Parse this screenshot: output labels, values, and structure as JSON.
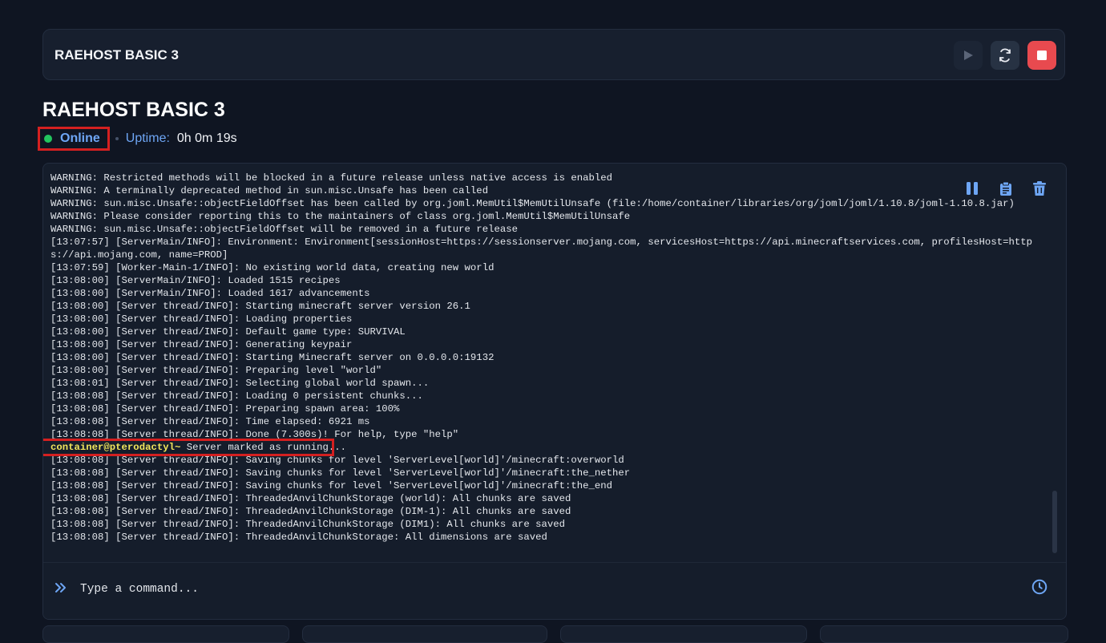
{
  "header": {
    "title": "RAEHOST BASIC 3",
    "controls": [
      "play-icon",
      "refresh-icon",
      "stop-icon"
    ],
    "stop_color": "#e84a4f"
  },
  "server": {
    "name": "RAEHOST BASIC 3",
    "status": "Online",
    "status_color": "#22c55e",
    "uptime_label": "Uptime:",
    "uptime_value": "0h 0m 19s"
  },
  "console": {
    "lines": [
      "WARNING: Restricted methods will be blocked in a future release unless native access is enabled",
      "WARNING: A terminally deprecated method in sun.misc.Unsafe has been called",
      "WARNING: sun.misc.Unsafe::objectFieldOffset has been called by org.joml.MemUtil$MemUtilUnsafe (file:/home/container/libraries/org/joml/joml/1.10.8/joml-1.10.8.jar)",
      "WARNING: Please consider reporting this to the maintainers of class org.joml.MemUtil$MemUtilUnsafe",
      "WARNING: sun.misc.Unsafe::objectFieldOffset will be removed in a future release",
      "[13:07:57] [ServerMain/INFO]: Environment: Environment[sessionHost=https://sessionserver.mojang.com, servicesHost=https://api.minecraftservices.com, profilesHost=https://api.mojang.com, name=PROD]",
      "[13:07:59] [Worker-Main-1/INFO]: No existing world data, creating new world",
      "[13:08:00] [ServerMain/INFO]: Loaded 1515 recipes",
      "[13:08:00] [ServerMain/INFO]: Loaded 1617 advancements",
      "[13:08:00] [Server thread/INFO]: Starting minecraft server version 26.1",
      "[13:08:00] [Server thread/INFO]: Loading properties",
      "[13:08:00] [Server thread/INFO]: Default game type: SURVIVAL",
      "[13:08:00] [Server thread/INFO]: Generating keypair",
      "[13:08:00] [Server thread/INFO]: Starting Minecraft server on 0.0.0.0:19132",
      "[13:08:00] [Server thread/INFO]: Preparing level \"world\"",
      "[13:08:01] [Server thread/INFO]: Selecting global world spawn...",
      "[13:08:08] [Server thread/INFO]: Loading 0 persistent chunks...",
      "[13:08:08] [Server thread/INFO]: Preparing spawn area: 100%",
      "[13:08:08] [Server thread/INFO]: Time elapsed: 6921 ms",
      "[13:08:08] [Server thread/INFO]: Done (7.300s)! For help, type \"help\""
    ],
    "prompt_user": "container@pterodactyl~",
    "prompt_message": " Server marked as running...",
    "lines_after": [
      "[13:08:08] [Server thread/INFO]: Saving chunks for level 'ServerLevel[world]'/minecraft:overworld",
      "[13:08:08] [Server thread/INFO]: Saving chunks for level 'ServerLevel[world]'/minecraft:the_nether",
      "[13:08:08] [Server thread/INFO]: Saving chunks for level 'ServerLevel[world]'/minecraft:the_end",
      "[13:08:08] [Server thread/INFO]: ThreadedAnvilChunkStorage (world): All chunks are saved",
      "[13:08:08] [Server thread/INFO]: ThreadedAnvilChunkStorage (DIM-1): All chunks are saved",
      "[13:08:08] [Server thread/INFO]: ThreadedAnvilChunkStorage (DIM1): All chunks are saved",
      "[13:08:08] [Server thread/INFO]: ThreadedAnvilChunkStorage: All dimensions are saved"
    ],
    "tools": [
      "pause-icon",
      "clipboard-icon",
      "trash-icon"
    ]
  },
  "command": {
    "placeholder": "Type a command..."
  }
}
